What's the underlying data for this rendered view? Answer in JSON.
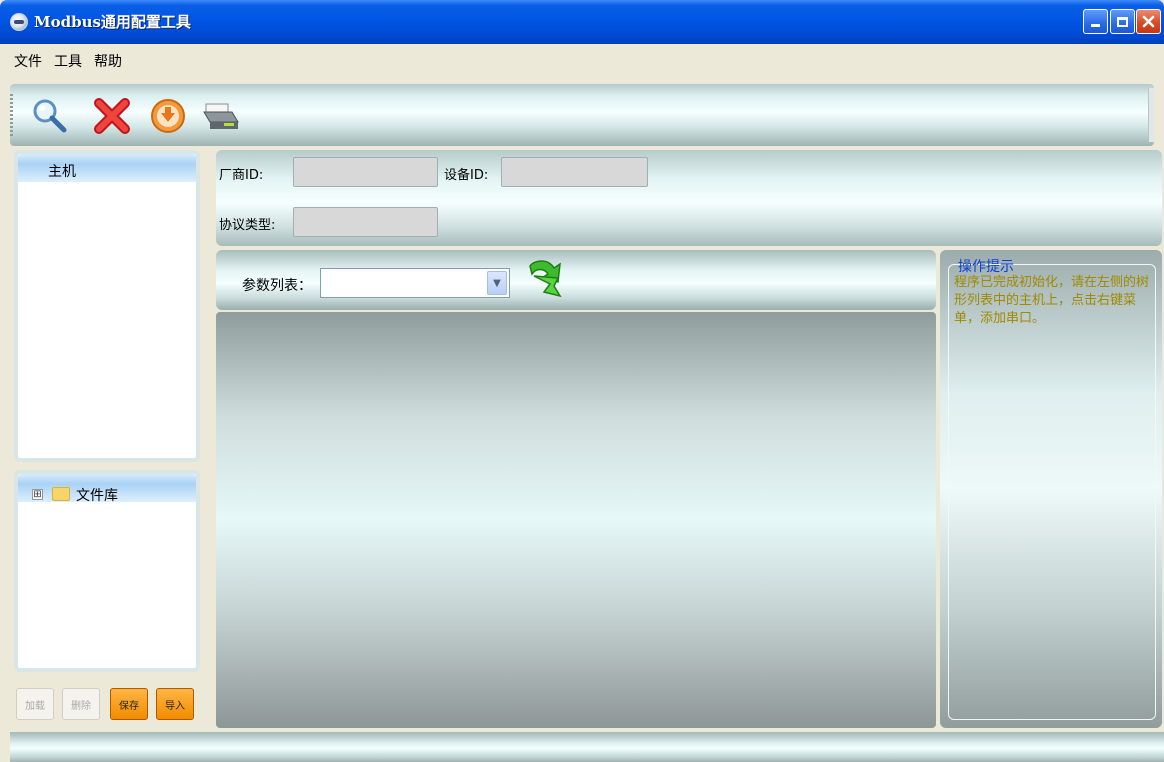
{
  "window": {
    "title": "Modbus通用配置工具",
    "controls": [
      "minimize",
      "maximize",
      "close"
    ]
  },
  "menu": {
    "items": [
      {
        "label": "文件"
      },
      {
        "label": "工具"
      },
      {
        "label": "帮助"
      }
    ]
  },
  "toolbar": {
    "icons": [
      "search-icon",
      "delete-icon",
      "download-icon",
      "print-icon"
    ]
  },
  "left_panel": {
    "host_title": "主机",
    "library_label": "文件库",
    "expand_glyph": "⊞",
    "buttons": {
      "load": "加载",
      "remove": "删除",
      "save": "保存",
      "import": "导入"
    }
  },
  "form": {
    "vendor_label": "厂商ID:",
    "vendor_value": "",
    "device_label": "设备ID:",
    "device_value": "",
    "protocol_label": "协议类型:",
    "protocol_value": ""
  },
  "params": {
    "label": "参数列表：",
    "selected": ""
  },
  "hint": {
    "title": "操作提示",
    "text": "程序已完成初始化，请在左侧的树形列表中的主机上，点击右键菜单，添加串口。"
  },
  "colors": {
    "title_bar": "#0054e3",
    "accent_orange": "#f28c00",
    "hint_title": "#0a3fd6",
    "hint_text": "#a08a00"
  }
}
